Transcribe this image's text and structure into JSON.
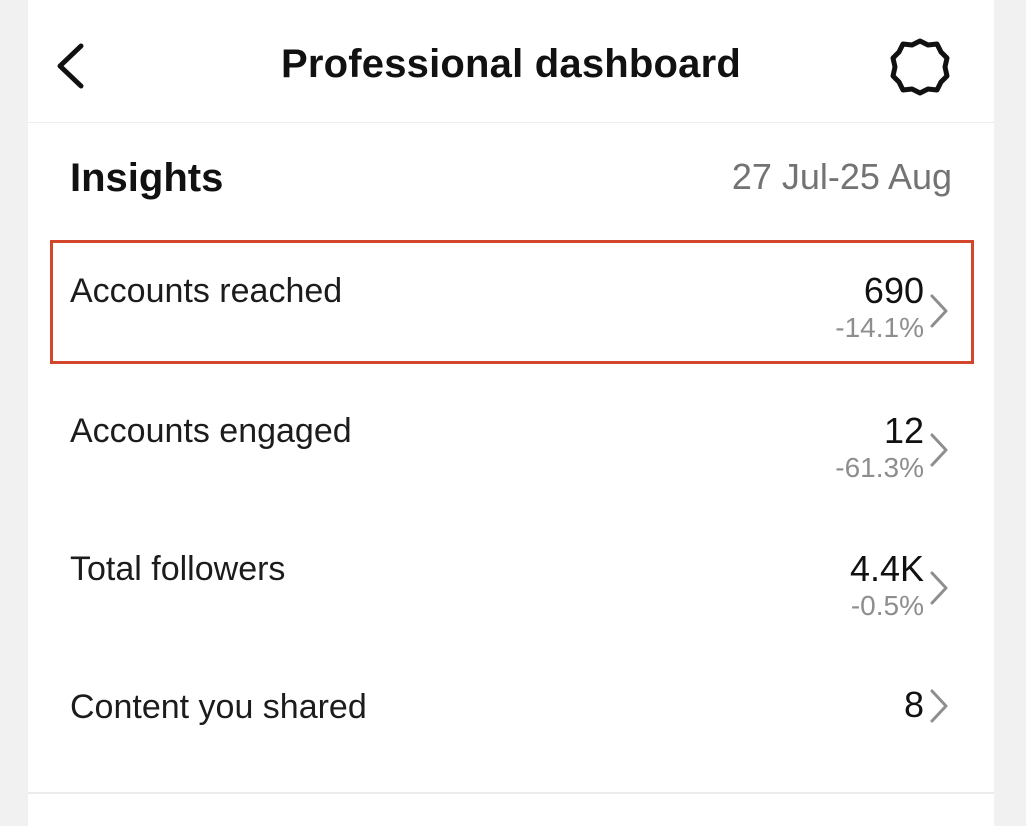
{
  "header": {
    "title": "Professional dashboard",
    "back_icon": "chevron-left-icon",
    "settings_icon": "gear-icon"
  },
  "insights": {
    "title": "Insights",
    "date_range": "27 Jul-25 Aug"
  },
  "metrics": [
    {
      "label": "Accounts reached",
      "value": "690",
      "change": "-14.1%",
      "highlighted": true
    },
    {
      "label": "Accounts engaged",
      "value": "12",
      "change": "-61.3%",
      "highlighted": false
    },
    {
      "label": "Total followers",
      "value": "4.4K",
      "change": "-0.5%",
      "highlighted": false
    },
    {
      "label": "Content you shared",
      "value": "8",
      "change": "",
      "highlighted": false
    }
  ],
  "colors": {
    "highlight_border": "#d2472b",
    "secondary_text": "#8e8e8e",
    "date_text": "#737373"
  }
}
